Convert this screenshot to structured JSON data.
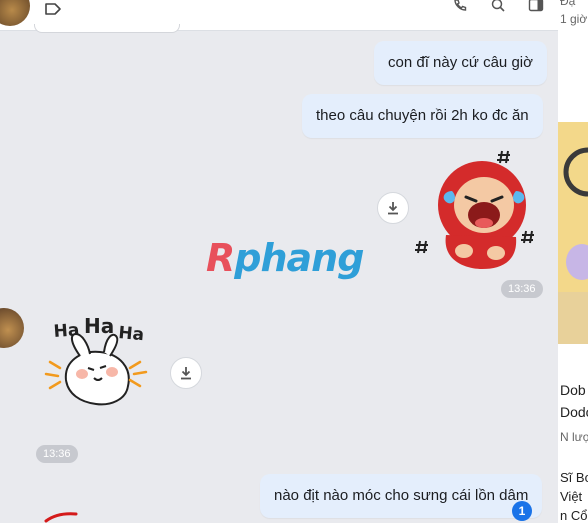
{
  "messages": [
    {
      "side": "right",
      "text": "con đĩ này cứ câu giờ"
    },
    {
      "side": "right",
      "text": "theo câu chuyện rồi 2h ko đc ăn"
    },
    {
      "side": "right",
      "text": "nào địt nào móc cho sưng cái lồn dâm"
    }
  ],
  "timestamps": {
    "sticker_right": "13:36",
    "sticker_left": "13:36"
  },
  "sticker_left": {
    "text": [
      "Ha",
      "Ha",
      "Ha"
    ]
  },
  "watermark": {
    "first": "R",
    "rest": "phang"
  },
  "right_panel": {
    "top_small": "Đạ",
    "top_time": "1 giờ",
    "lines": [
      "Dob",
      "Dodo",
      "N lượ",
      "Sĩ Bo",
      "Việt",
      "n Cổ"
    ]
  },
  "unread_badge": "1",
  "colors": {
    "bubble": "#e4eefc",
    "background": "#e9eaee",
    "badge": "#1a73e8"
  },
  "icons": [
    "tag-icon",
    "phone-icon",
    "search-icon",
    "sidebar-icon",
    "download-icon"
  ]
}
